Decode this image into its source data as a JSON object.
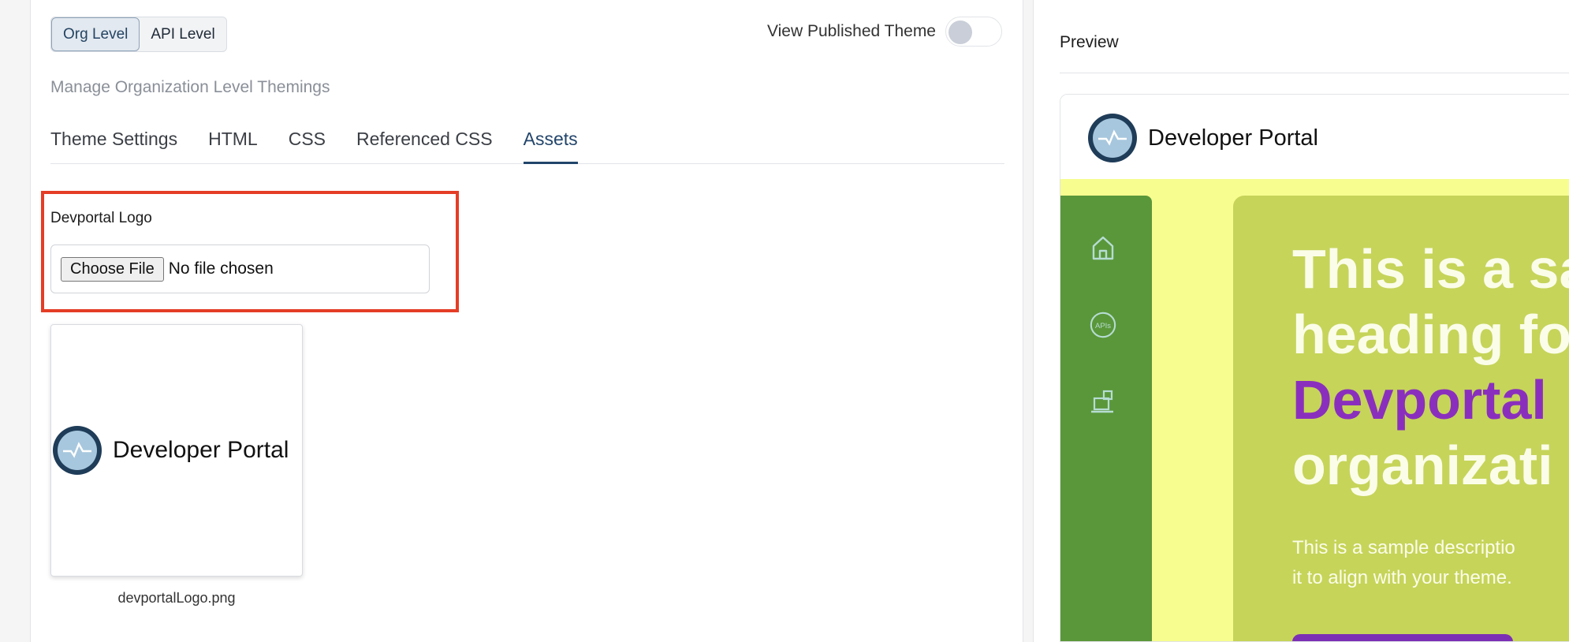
{
  "level_switch": {
    "org": "Org Level",
    "api": "API Level"
  },
  "view_published": {
    "label": "View Published Theme",
    "enabled": false
  },
  "subtitle": "Manage Organization Level Themings",
  "tabs": [
    {
      "label": "Theme Settings",
      "active": false
    },
    {
      "label": "HTML",
      "active": false
    },
    {
      "label": "CSS",
      "active": false
    },
    {
      "label": "Referenced CSS",
      "active": false
    },
    {
      "label": "Assets",
      "active": true
    }
  ],
  "asset": {
    "label": "Devportal Logo",
    "choose_button": "Choose File",
    "file_status": "No file chosen",
    "thumbnail_brand": "Developer Portal",
    "filename": "devportalLogo.png"
  },
  "preview": {
    "title": "Preview",
    "brand": "Developer Portal",
    "nav_icons": [
      "home-icon",
      "apis-icon",
      "laptop-icon"
    ],
    "apis_icon_text": "APIs",
    "heading_line1": "This is a sa",
    "heading_line2": "heading fo",
    "heading_accent": "Devportal",
    "heading_line4": "organizati",
    "description_line1": "This is a sample descriptio",
    "description_line2": "it to align with your theme."
  },
  "colors": {
    "accent_tab": "#22456b",
    "highlight_border": "#e43d26",
    "preview_background": "#f7fd8f",
    "preview_sidebar": "#5a973a",
    "preview_card": "#c6d45a",
    "preview_accent": "#8a2fbd"
  }
}
